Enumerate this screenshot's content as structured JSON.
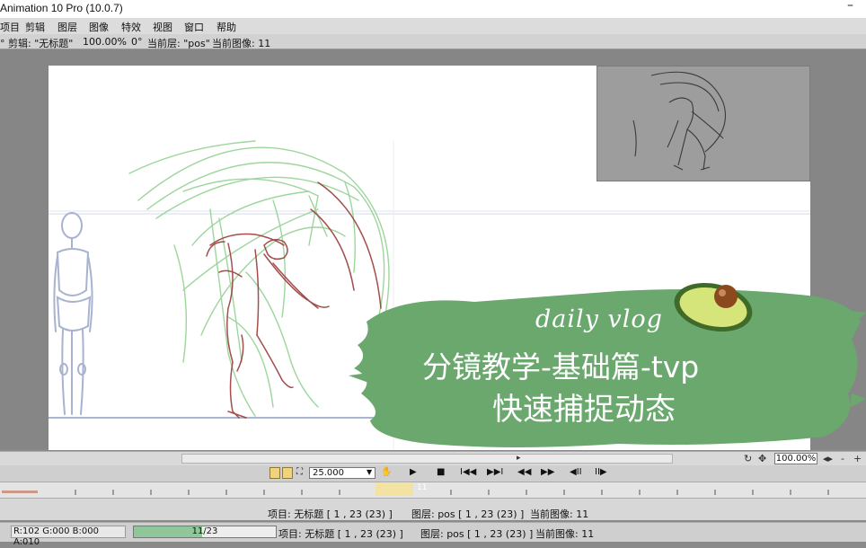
{
  "window": {
    "title": "Animation 10 Pro (10.0.7)",
    "minimize": "–"
  },
  "menu": [
    "项目",
    "剪辑",
    "图层",
    "图像",
    "特效",
    "视图",
    "窗口",
    "帮助"
  ],
  "infobar": {
    "left": "°  剪辑: \"无标题\"",
    "zoom": "100.00%",
    "angle": "0°",
    "layer": "当前层: \"pos\"",
    "image": "当前图像: 11"
  },
  "overlay": {
    "vlog": "daily vlog",
    "title_line1": "分镜教学-基础篇-tvp",
    "title_line2": "快速捕捉动态",
    "green": "#6aa86e"
  },
  "scroll": {
    "zoom": "100.00%",
    "minus": "-",
    "plus": "+"
  },
  "playbar": {
    "fps": "25.000",
    "play": "▶",
    "stop": "■",
    "first": "I◀◀",
    "last": "▶▶I",
    "prev": "◀◀",
    "next": "▶▶",
    "step_back": "◀II",
    "step_fwd": "II▶"
  },
  "timeline": {
    "current_frame": "11"
  },
  "status1": {
    "project": "项目: 无标题 [ 1 , 23  (23) ]",
    "layer": "图层: pos [ 1 , 23  (23) ]",
    "image": "当前图像: 11"
  },
  "status2": {
    "rgba": "R:102 G:000 B:000 A:010",
    "frame": "11/23",
    "frame_fraction": 0.478,
    "project": "项目: 无标题 [ 1 , 23  (23) ]",
    "layer": "图层: pos [ 1 , 23  (23) ]",
    "image": "当前图像: 11"
  }
}
